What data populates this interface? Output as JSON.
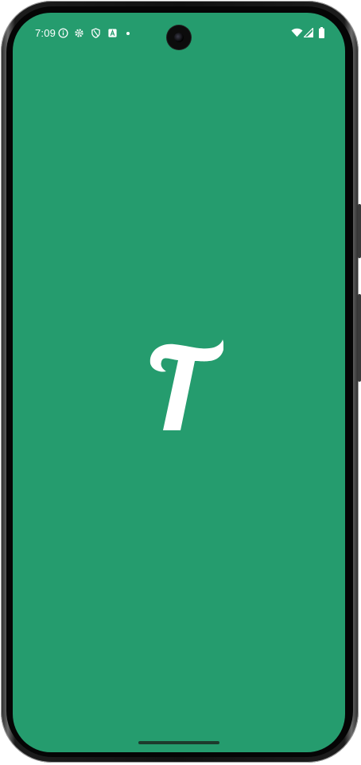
{
  "status_bar": {
    "time": "7:09",
    "left_icons": [
      "info-icon",
      "gear-icon",
      "shield-icon",
      "a-icon",
      "dot-icon"
    ],
    "right_icons": [
      "wifi-icon",
      "signal-icon",
      "battery-icon"
    ]
  },
  "splash": {
    "background_color": "#259c6e",
    "logo_icon": "t-logo-icon",
    "logo_color": "#ffffff"
  }
}
